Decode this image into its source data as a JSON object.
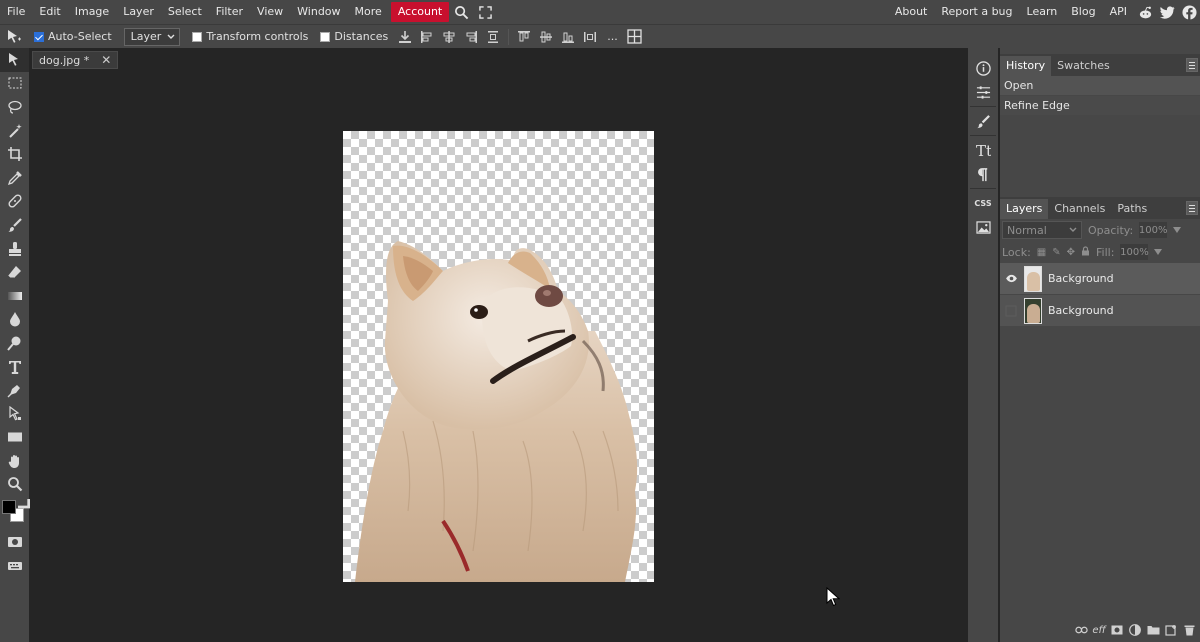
{
  "menubar": {
    "items": [
      "File",
      "Edit",
      "Image",
      "Layer",
      "Select",
      "Filter",
      "View",
      "Window",
      "More"
    ],
    "account_label": "Account",
    "right_items": [
      "About",
      "Report a bug",
      "Learn",
      "Blog",
      "API"
    ],
    "icons": [
      "search-icon",
      "fullscreen-icon",
      "reddit-icon",
      "twitter-icon",
      "facebook-icon"
    ]
  },
  "options": {
    "auto_select_label": "Auto-Select",
    "auto_select_checked": true,
    "layer_select_value": "Layer",
    "transform_controls_label": "Transform controls",
    "transform_controls_checked": false,
    "distances_label": "Distances",
    "distances_checked": false,
    "more_label": "..."
  },
  "document": {
    "tab_title": "dog.jpg *",
    "close_label": "✕"
  },
  "history": {
    "tabs": [
      "History",
      "Swatches"
    ],
    "items": [
      "Open",
      "Refine Edge"
    ]
  },
  "layers": {
    "tabs": [
      "Layers",
      "Channels",
      "Paths"
    ],
    "blend_mode": "Normal",
    "opacity_label": "Opacity:",
    "opacity_value": "100%",
    "lock_label": "Lock:",
    "fill_label": "Fill:",
    "fill_value": "100%",
    "rows": [
      {
        "name": "Background",
        "visible": true
      },
      {
        "name": "Background",
        "visible": false
      }
    ]
  },
  "icon_strip": {
    "css_label": "CSS",
    "icons": [
      "info-icon",
      "adjustments-icon",
      "brush-settings-icon",
      "character-icon",
      "paragraph-icon",
      "css-icon",
      "image-icon"
    ]
  },
  "colors": {
    "accent": "#c8102e",
    "foreground_color": "#000000",
    "background_color": "#ffffff",
    "checkbox_checked": "#2b6fd8"
  }
}
